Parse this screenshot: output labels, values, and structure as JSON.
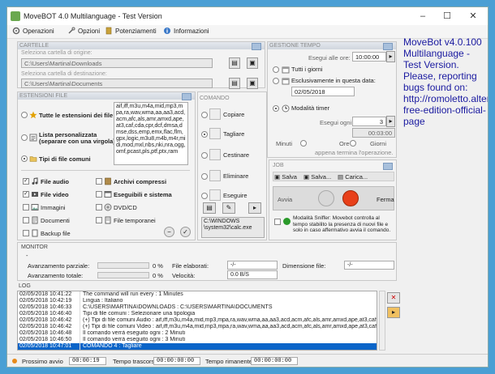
{
  "window": {
    "title": "MoveBOT 4.0 Multilanguage - Test Version",
    "min": "–",
    "max": "☐",
    "close": "✕"
  },
  "menu": [
    "Operazioni",
    "Opzioni",
    "Potenziamenti",
    "Informazioni"
  ],
  "cartelle": {
    "title": "CARTELLE",
    "origin_label": "Seleziona cartella di origine:",
    "origin_value": "C:\\Users\\Martina\\Downloads",
    "dest_label": "Seleziona cartella di destinazione:",
    "dest_value": "C:\\Users\\Martina\\Documents"
  },
  "gestione": {
    "title": "GESTIONE TEMPO",
    "exec_at_label": "Esegui alle ore:",
    "exec_at_value": "10:00:00",
    "every_day": "Tutti i giorni",
    "only_date": "Esclusivamente in questa data:",
    "date_value": "02/05/2018",
    "timer_mode": "Modalità timer",
    "every_label": "Esegui ogni:",
    "every_value": "3",
    "time_value": "00:03:00",
    "minutes": "Minuti",
    "hours": "Ore",
    "days": "Giorni",
    "after_op": "appena termina l'operazione."
  },
  "estensioni": {
    "title": "ESTENSIONI FILE",
    "all_ext": "Tutte le estensioni dei file",
    "custom_list": "Lista personalizzata",
    "custom_list_2": "(separare con una virgola)",
    "common_types": "Tipi di file comuni",
    "ext_text": "aif,iff,m3u,m4a,mid,mp3,mpa,ra,wav,wma,aa,aa3,acd,acm,afc,als,amr,amxd,ape,at3,caf,cda,cpr,dcf,dmsa,dmse,dss,emp,emx,flac,flm,gpx,logic,m3u8,m4b,m4r,midi,mod,mxl,nbs,nki,nra,ogg,omf,pcast,pls,ptf,ptx,ram",
    "checks": [
      {
        "label": "File audio",
        "checked": true
      },
      {
        "label": "Archivi compressi",
        "checked": false
      },
      {
        "label": "File video",
        "checked": true
      },
      {
        "label": "Eseguibili e sistema",
        "checked": false
      },
      {
        "label": "Immagini",
        "checked": false
      },
      {
        "label": "DVD/CD",
        "checked": false
      },
      {
        "label": "Documenti",
        "checked": false
      },
      {
        "label": "File temporanei",
        "checked": false
      },
      {
        "label": "Backup file",
        "checked": false
      }
    ]
  },
  "comando": {
    "title": "COMANDO",
    "items": [
      "Copiare",
      "Tagliare",
      "Cestinare",
      "Eliminare",
      "Eseguire"
    ],
    "exec_path": "C:\\WINDOWS\n\\system32\\calc.exe"
  },
  "job": {
    "title": "JOB",
    "save": "Salva",
    "save_as": "Salva...",
    "load": "Carica...",
    "start": "Avvia",
    "stop": "Ferma",
    "sniffer": "Modalità Sniffer: Movebot controlla al tempo stabilito la presenza di nuovi file e solo in caso affermativo avvia il comando."
  },
  "monitor": {
    "title": "MONITOR",
    "dash": "-",
    "partial_label": "Avanzamento parziale:",
    "partial_value": "0 %",
    "total_label": "Avanzamento totale:",
    "total_value": "0 %",
    "elab_label": "File elaborati:",
    "elab_value": "-/-",
    "speed_label": "Velocità:",
    "speed_value": "0.0 B/S",
    "dim_label": "Dimensione file:",
    "dim_value": "-/-"
  },
  "log": {
    "title": "LOG",
    "rows": [
      {
        "time": "02/05/2018 10:41:22",
        "msg": "The command will run every : 1 Minutes",
        "sel": false
      },
      {
        "time": "02/05/2018 10:42:19",
        "msg": "Lingua : Italiano",
        "sel": false
      },
      {
        "time": "02/05/2018 10:46:33",
        "msg": "C:\\USERS\\MARTINA\\DOWNLOADS : C:\\USERS\\MARTINA\\DOCUMENTS",
        "sel": false
      },
      {
        "time": "02/05/2018 10:46:40",
        "msg": "Tipi di file comuni : Selezionare una tipologia",
        "sel": false
      },
      {
        "time": "02/05/2018 10:46:42",
        "msg": "(+) Tipi di file comuni Audio : aif,iff,m3u,m4a,mid,mp3,mpa,ra,wav,wma,aa,aa3,acd,acm,afc,als,amr,amxd,ape,at3,caf",
        "sel": false
      },
      {
        "time": "02/05/2018 10:46:42",
        "msg": "(+) Tipi di file comuni Video : aif,iff,m3u,m4a,mid,mp3,mpa,ra,wav,wma,aa,aa3,acd,acm,afc,als,amr,amxd,ape,at3,caf",
        "sel": false
      },
      {
        "time": "02/05/2018 10:46:48",
        "msg": "Il comando verrà eseguito ogni : 2 Minuti",
        "sel": false
      },
      {
        "time": "02/05/2018 10:46:50",
        "msg": "Il comando verrà eseguito ogni : 3 Minuti",
        "sel": false
      },
      {
        "time": "02/05/2018 10:47:01",
        "msg": "COMANDO 4 : Tagliare",
        "sel": true
      }
    ]
  },
  "status": {
    "next_label": "Prossimo avvio",
    "next_value": "00:00:19",
    "elapsed_label": "Tempo trascorso",
    "elapsed_value": "00:00:00:00",
    "remaining_label": "Tempo rimanente",
    "remaining_value": "00:00:00:00"
  },
  "note": "MoveBot v4.0.100 Multilanguage - Test Version. Please, reporting bugs found on: http://romoletto.altervista.org/movebot-free-edition-official-page",
  "colors": {
    "accent": "#0a64c8",
    "note": "#1a1aa0",
    "stop": "#e8401a"
  }
}
